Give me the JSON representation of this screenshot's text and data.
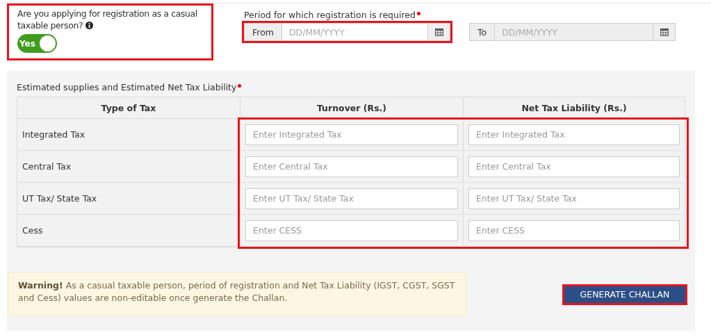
{
  "casual_question": {
    "label": "Are you applying for registration as a casual taxable person?",
    "highlighted": true,
    "toggle": {
      "label": "Yes",
      "on": true
    }
  },
  "period": {
    "label": "Period for which registration is required",
    "required": true,
    "highlighted": true,
    "from": {
      "addon": "From",
      "placeholder": "DD/MM/YYYY",
      "disabled": false
    },
    "to": {
      "addon": "To",
      "placeholder": "DD/MM/YYYY",
      "disabled": true
    }
  },
  "estimates": {
    "label": "Estimated supplies and Estimated Net Tax Liability",
    "required": true,
    "table": {
      "columns": [
        "Type of Tax",
        "Turnover (Rs.)",
        "Net Tax Liability (Rs.)"
      ],
      "inputs_highlighted": true,
      "rows": [
        {
          "type": "Integrated Tax",
          "turnover_placeholder": "Enter Integrated Tax",
          "liability_placeholder": "Enter Integrated Tax"
        },
        {
          "type": "Central Tax",
          "turnover_placeholder": "Enter Central Tax",
          "liability_placeholder": "Enter Central Tax"
        },
        {
          "type": "UT Tax/ State Tax",
          "turnover_placeholder": "Enter UT Tax/ State Tax",
          "liability_placeholder": "Enter UT Tax/ State Tax"
        },
        {
          "type": "Cess",
          "turnover_placeholder": "Enter CESS",
          "liability_placeholder": "Enter CESS"
        }
      ]
    }
  },
  "warning": "**Warning!** As a casual taxable person, period of registration and Net Tax Liability (IGST, CGST, SGST and Cess) values are non-editable once generate the Challan.",
  "generate_button": {
    "label": "GENERATE CHALLAN",
    "highlighted": true
  }
}
